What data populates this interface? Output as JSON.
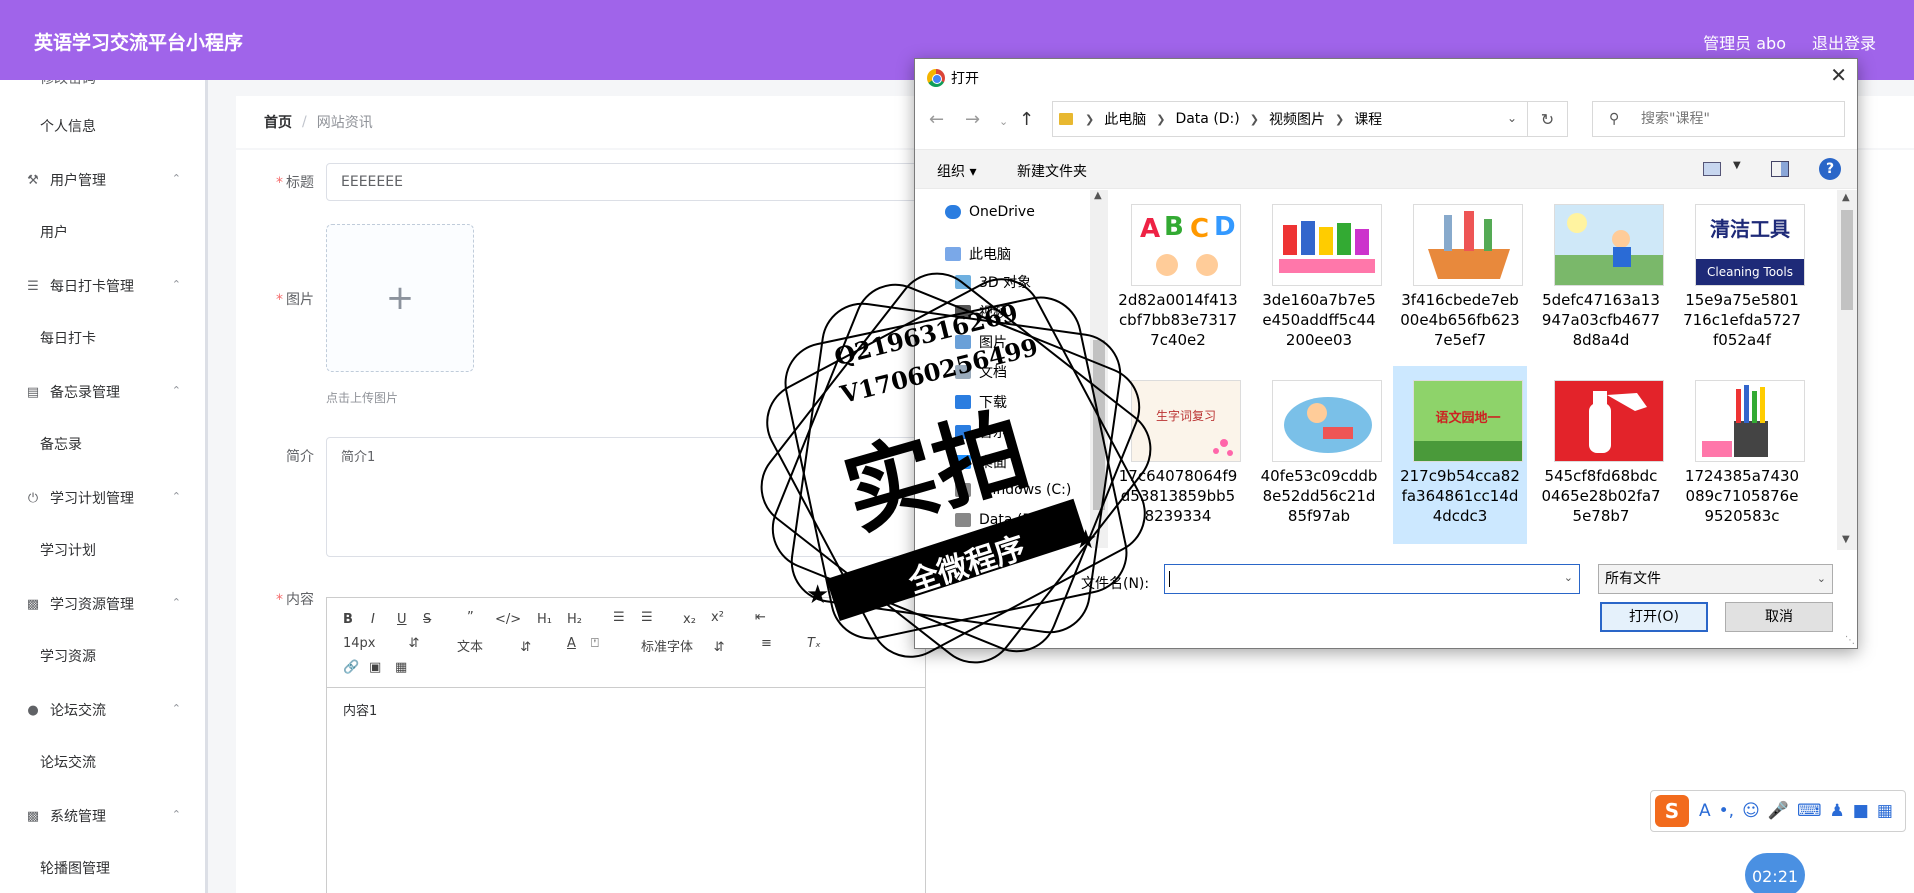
{
  "header": {
    "app_title": "英语学习交流平台小程序",
    "admin_label": "管理员 abo",
    "logout_label": "退出登录"
  },
  "sidebar": {
    "cut_item": "修改密码",
    "personal_info": "个人信息",
    "groups": [
      {
        "label": "用户管理",
        "icon": "user-manage-icon",
        "sub": "用户"
      },
      {
        "label": "每日打卡管理",
        "icon": "list-icon",
        "sub": "每日打卡"
      },
      {
        "label": "备忘录管理",
        "icon": "card-icon",
        "sub": "备忘录"
      },
      {
        "label": "学习计划管理",
        "icon": "power-icon",
        "sub": "学习计划"
      },
      {
        "label": "学习资源管理",
        "icon": "monitor-icon",
        "sub": "学习资源"
      },
      {
        "label": "论坛交流",
        "icon": "camera-icon",
        "sub": "论坛交流"
      },
      {
        "label": "系统管理",
        "icon": "monitor-icon",
        "sub": "轮播图管理"
      }
    ]
  },
  "breadcrumb": {
    "home": "首页",
    "sep": "/",
    "current": "网站资讯"
  },
  "form": {
    "title_label": "标题",
    "title_value": "EEEEEEE",
    "image_label": "图片",
    "upload_tip": "点击上传图片",
    "brief_label": "简介",
    "brief_value": "简介1",
    "content_label": "内容",
    "content_value": "内容1",
    "editor": {
      "font_size": "14px",
      "block_type": "文本",
      "font_family": "标准字体"
    }
  },
  "dialog": {
    "title": "打开",
    "path": [
      "此电脑",
      "Data (D:)",
      "视频图片",
      "课程"
    ],
    "search_placeholder": "搜索\"课程\"",
    "organize_label": "组织 ▾",
    "new_folder_label": "新建文件夹",
    "nav_items": [
      "OneDrive",
      "此电脑",
      "3D 对象",
      "视频",
      "图片",
      "文档",
      "下载",
      "音乐",
      "桌面",
      "Windows (C:)",
      "Data (D:)"
    ],
    "files": [
      {
        "name": "2d82a0014f413cbf7bb83e73177c40e2",
        "thumb": "abcd-kids"
      },
      {
        "name": "3de160a7b7e5e450addff5c44200ee03",
        "thumb": "paint-supplies"
      },
      {
        "name": "3f416cbede7eb00e4b656fb6237e5ef7",
        "thumb": "cleaning-bucket"
      },
      {
        "name": "5defc47163a13947a03cfb46778d8a4d",
        "thumb": "boy-moon"
      },
      {
        "name": "15e9a75e5801716c1efda5727f052a4f",
        "thumb": "cleaning-tools-card"
      },
      {
        "name": "17c64078064f9d53813859bb58239334",
        "thumb": "word-review-card"
      },
      {
        "name": "40fe53c09cddb8e52dd56c21d85f97ab",
        "thumb": "cartoon-plane"
      },
      {
        "name": "217c9b54cca82fa364861cc14d4dcdc3",
        "thumb": "chinese-garden"
      },
      {
        "name": "545cf8fd68bdc0465e28b02fa75e78b7",
        "thumb": "fire-extinguisher"
      },
      {
        "name": "1724385a7430089c7105876e9520583c",
        "thumb": "pencil-cup"
      }
    ],
    "thumb_text": {
      "cleaning_tools_cn": "清洁工具",
      "cleaning_tools_en": "Cleaning Tools",
      "word_review": "生字词复习",
      "garden": "语文园地一"
    },
    "filename_label": "文件名(N):",
    "filename_value": "",
    "filetype_value": "所有文件",
    "open_label": "打开(O)",
    "cancel_label": "取消"
  },
  "watermark": {
    "line1": "Q2196316269",
    "line2": "V17060256499",
    "main": "实拍",
    "ribbon": "全微程序"
  },
  "clock": "02:21"
}
